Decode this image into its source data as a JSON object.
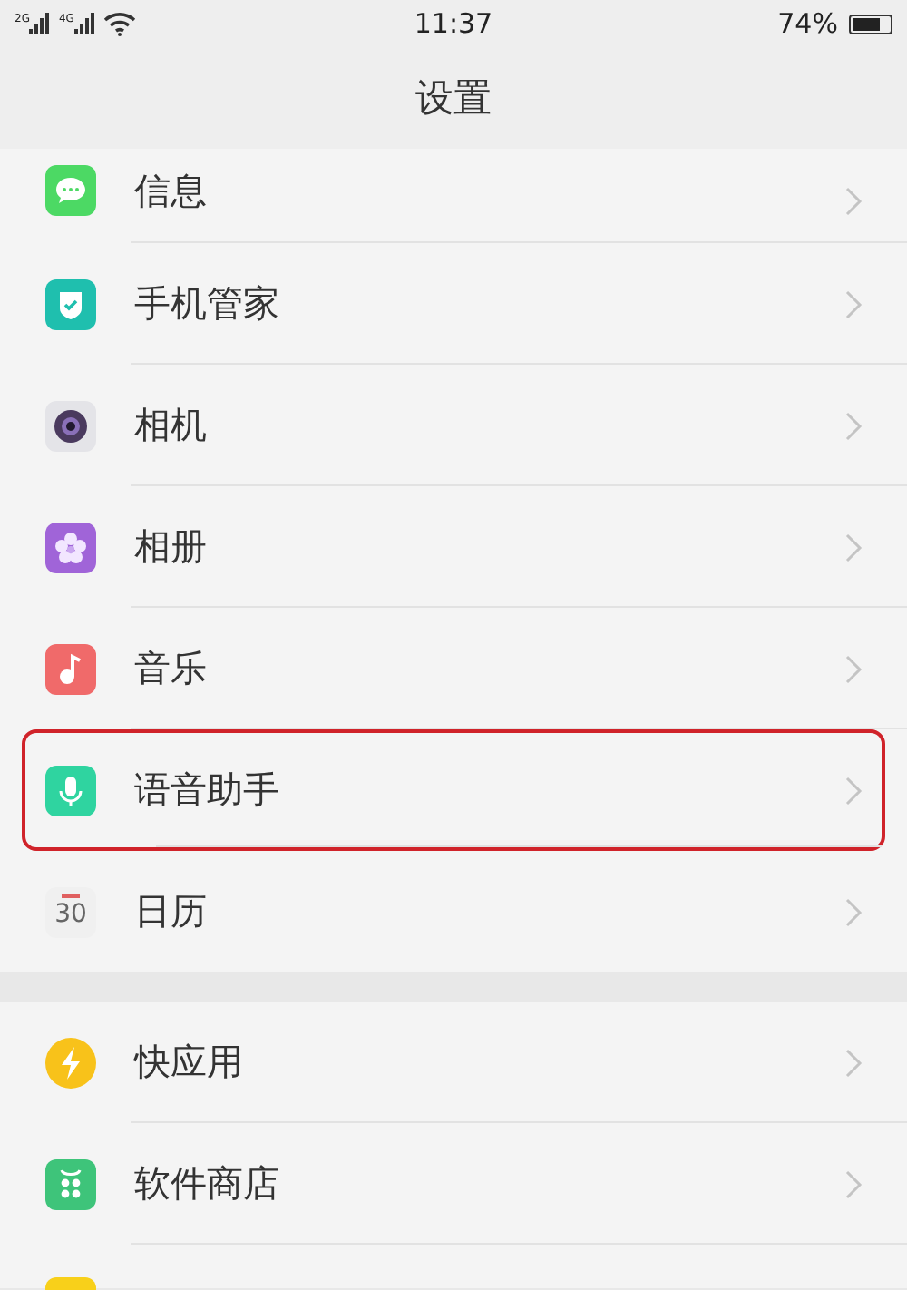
{
  "status_bar": {
    "signal_labels": [
      "2G",
      "4G"
    ],
    "time": "11:37",
    "battery_text": "74%"
  },
  "header": {
    "title": "设置"
  },
  "sections": [
    {
      "items": [
        {
          "label": "信息",
          "kind": "message",
          "highlighted": false
        },
        {
          "label": "手机管家",
          "kind": "shield",
          "highlighted": false
        },
        {
          "label": "相机",
          "kind": "camera",
          "highlighted": false
        },
        {
          "label": "相册",
          "kind": "flower",
          "highlighted": false
        },
        {
          "label": "音乐",
          "kind": "music",
          "highlighted": false
        },
        {
          "label": "语音助手",
          "kind": "mic",
          "highlighted": true
        },
        {
          "label": "日历",
          "kind": "calendar",
          "icon_text": "30",
          "highlighted": false
        }
      ]
    },
    {
      "items": [
        {
          "label": "快应用",
          "kind": "bolt",
          "highlighted": false
        },
        {
          "label": "软件商店",
          "kind": "store",
          "highlighted": false
        },
        {
          "kind": "partial",
          "highlighted": false
        }
      ]
    }
  ]
}
